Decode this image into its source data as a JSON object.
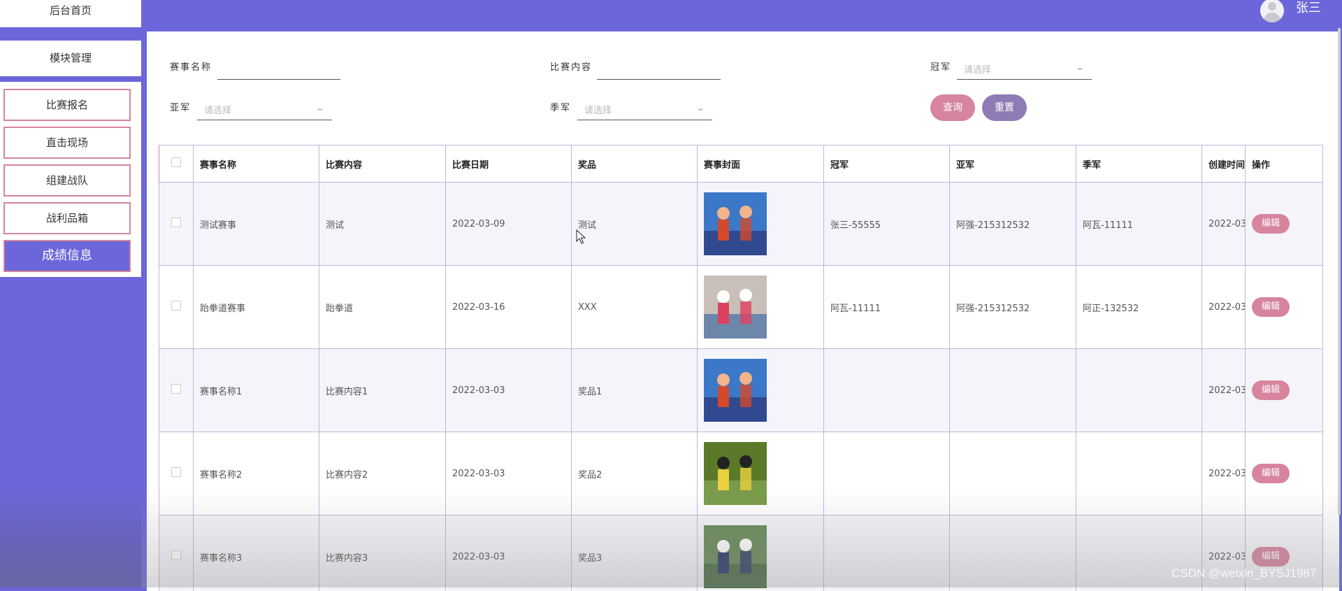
{
  "sidebar": {
    "home_label": "后台首页",
    "module_label": "模块管理",
    "items": [
      {
        "label": "比赛报名"
      },
      {
        "label": "直击现场"
      },
      {
        "label": "组建战队"
      },
      {
        "label": "战利品箱"
      },
      {
        "label": "成绩信息",
        "active": true
      }
    ]
  },
  "header": {
    "username": "张三"
  },
  "search": {
    "name_label": "赛事名称",
    "content_label": "比赛内容",
    "champion_label": "冠军",
    "runner_up_label": "亚军",
    "third_label": "季军",
    "select_placeholder": "请选择",
    "query_button": "查询",
    "reset_button": "重置"
  },
  "table": {
    "columns": [
      "赛事名称",
      "比赛内容",
      "比赛日期",
      "奖品",
      "赛事封面",
      "冠军",
      "亚军",
      "季军",
      "创建时间",
      "操作"
    ],
    "edit_label": "编辑",
    "rows": [
      {
        "name": "测试赛事",
        "content": "测试",
        "date": "2022-03-09",
        "prize": "测试",
        "champion": "张三-55555",
        "runner_up": "阿强-215312532",
        "third": "阿瓦-11111",
        "created": "2022-03"
      },
      {
        "name": "跆拳道赛事",
        "content": "跆拳道",
        "date": "2022-03-16",
        "prize": "XXX",
        "champion": "阿瓦-11111",
        "runner_up": "阿强-215312532",
        "third": "阿正-132532",
        "created": "2022-03"
      },
      {
        "name": "赛事名称1",
        "content": "比赛内容1",
        "date": "2022-03-03",
        "prize": "奖品1",
        "champion": "",
        "runner_up": "",
        "third": "",
        "created": "2022-03"
      },
      {
        "name": "赛事名称2",
        "content": "比赛内容2",
        "date": "2022-03-03",
        "prize": "奖品2",
        "champion": "",
        "runner_up": "",
        "third": "",
        "created": "2022-03"
      },
      {
        "name": "赛事名称3",
        "content": "比赛内容3",
        "date": "2022-03-03",
        "prize": "奖品3",
        "champion": "",
        "runner_up": "",
        "third": "",
        "created": "2022-03"
      }
    ]
  },
  "watermark": "CSDN @weixin_BYSJ1987",
  "colors": {
    "primary": "#6b66d9",
    "accent_pink": "#d7849e",
    "accent_purple": "#8e7ab4"
  }
}
